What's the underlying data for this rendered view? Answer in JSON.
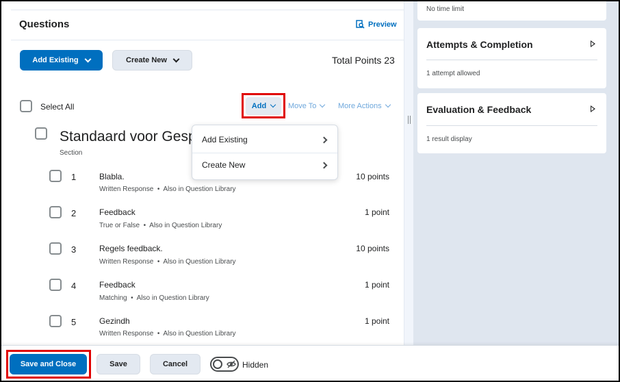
{
  "questions_panel": {
    "title": "Questions",
    "preview_label": "Preview",
    "add_existing_label": "Add Existing",
    "create_new_label": "Create New",
    "total_points": "Total Points 23",
    "select_all_label": "Select All",
    "add_label": "Add",
    "move_to_label": "Move To",
    "more_actions_label": "More Actions"
  },
  "section": {
    "title": "Standaard voor Gesp",
    "subtitle": "Section"
  },
  "dropdown": {
    "items": [
      {
        "label": "Add Existing"
      },
      {
        "label": "Create New"
      }
    ]
  },
  "question_list": [
    {
      "number": "1",
      "name": "Blabla.",
      "type": "Written Response",
      "library": "Also in Question Library",
      "points": "10 points"
    },
    {
      "number": "2",
      "name": "Feedback",
      "type": "True or False",
      "library": "Also in Question Library",
      "points": "1 point"
    },
    {
      "number": "3",
      "name": "Regels feedback.",
      "type": "Written Response",
      "library": "Also in Question Library",
      "points": "10 points"
    },
    {
      "number": "4",
      "name": "Feedback",
      "type": "Matching",
      "library": "Also in Question Library",
      "points": "1 point"
    },
    {
      "number": "5",
      "name": "Gezindh",
      "type": "Written Response",
      "library": "Also in Question Library",
      "points": "1 point"
    }
  ],
  "sidebar": {
    "time_limit_text": "No time limit",
    "cards": [
      {
        "title": "Attempts & Completion",
        "summary": "1 attempt allowed"
      },
      {
        "title": "Evaluation & Feedback",
        "summary": "1 result display"
      }
    ]
  },
  "footer": {
    "save_close_label": "Save and Close",
    "save_label": "Save",
    "cancel_label": "Cancel",
    "visibility_label": "Hidden"
  },
  "colors": {
    "primary": "#006fbf",
    "highlight_box": "#e00000",
    "sidebar_bg": "#dfe6ef"
  }
}
